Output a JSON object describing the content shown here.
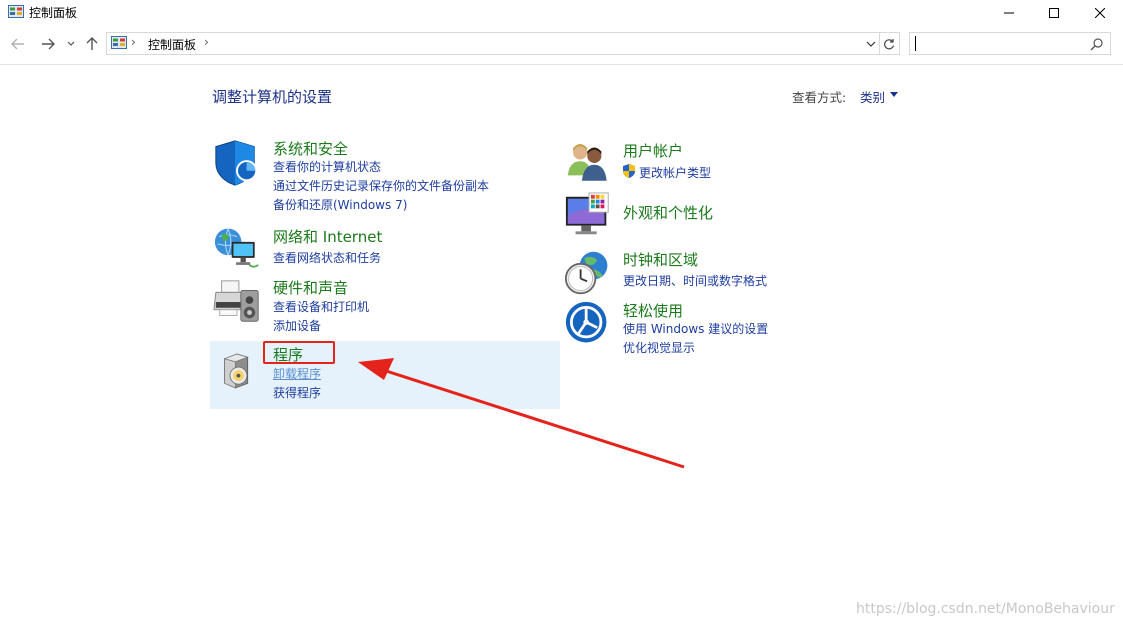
{
  "window": {
    "title": "控制面板",
    "minimize_icon": "minimize-icon",
    "maximize_icon": "maximize-icon",
    "close_icon": "close-icon"
  },
  "nav": {
    "breadcrumb": "控制面板",
    "search_placeholder": "",
    "icons": [
      "back-arrow-icon",
      "forward-arrow-icon",
      "chevron-down-icon",
      "up-arrow-icon",
      "control-panel-icon",
      "refresh-icon",
      "search-icon"
    ]
  },
  "header": {
    "title": "调整计算机的设置",
    "view_label": "查看方式:",
    "view_value": "类别"
  },
  "categories": {
    "system_security": {
      "title": "系统和安全",
      "icon": "shield-icon",
      "links": [
        "查看你的计算机状态",
        "通过文件历史记录保存你的文件备份副本",
        "备份和还原(Windows 7)"
      ]
    },
    "network": {
      "title": "网络和 Internet",
      "icon": "network-globe-icon",
      "links": [
        "查看网络状态和任务"
      ]
    },
    "hardware": {
      "title": "硬件和声音",
      "icon": "printer-icon",
      "links": [
        "查看设备和打印机",
        "添加设备"
      ]
    },
    "programs": {
      "title": "程序",
      "icon": "programs-disc-icon",
      "links": [
        "卸载程序",
        "获得程序"
      ]
    },
    "user_accounts": {
      "title": "用户帐户",
      "icon": "users-icon",
      "links": [
        "更改帐户类型"
      ],
      "link_icon": "uac-shield-icon"
    },
    "appearance": {
      "title": "外观和个性化",
      "icon": "monitor-palette-icon",
      "links": []
    },
    "clock_region": {
      "title": "时钟和区域",
      "icon": "clock-globe-icon",
      "links": [
        "更改日期、时间或数字格式"
      ]
    },
    "ease_of_access": {
      "title": "轻松使用",
      "icon": "accessibility-icon",
      "links": [
        "使用 Windows 建议的设置",
        "优化视觉显示"
      ]
    }
  },
  "annotation": {
    "box_color": "#e5231d",
    "arrow_color": "#e5231d"
  },
  "watermark": "https://blog.csdn.net/MonoBehaviour",
  "colors": {
    "category_title": "#1b7a1b",
    "link": "#1e3ea0",
    "header_title": "#1e3287",
    "hover_bg": "#e5f1fb"
  }
}
